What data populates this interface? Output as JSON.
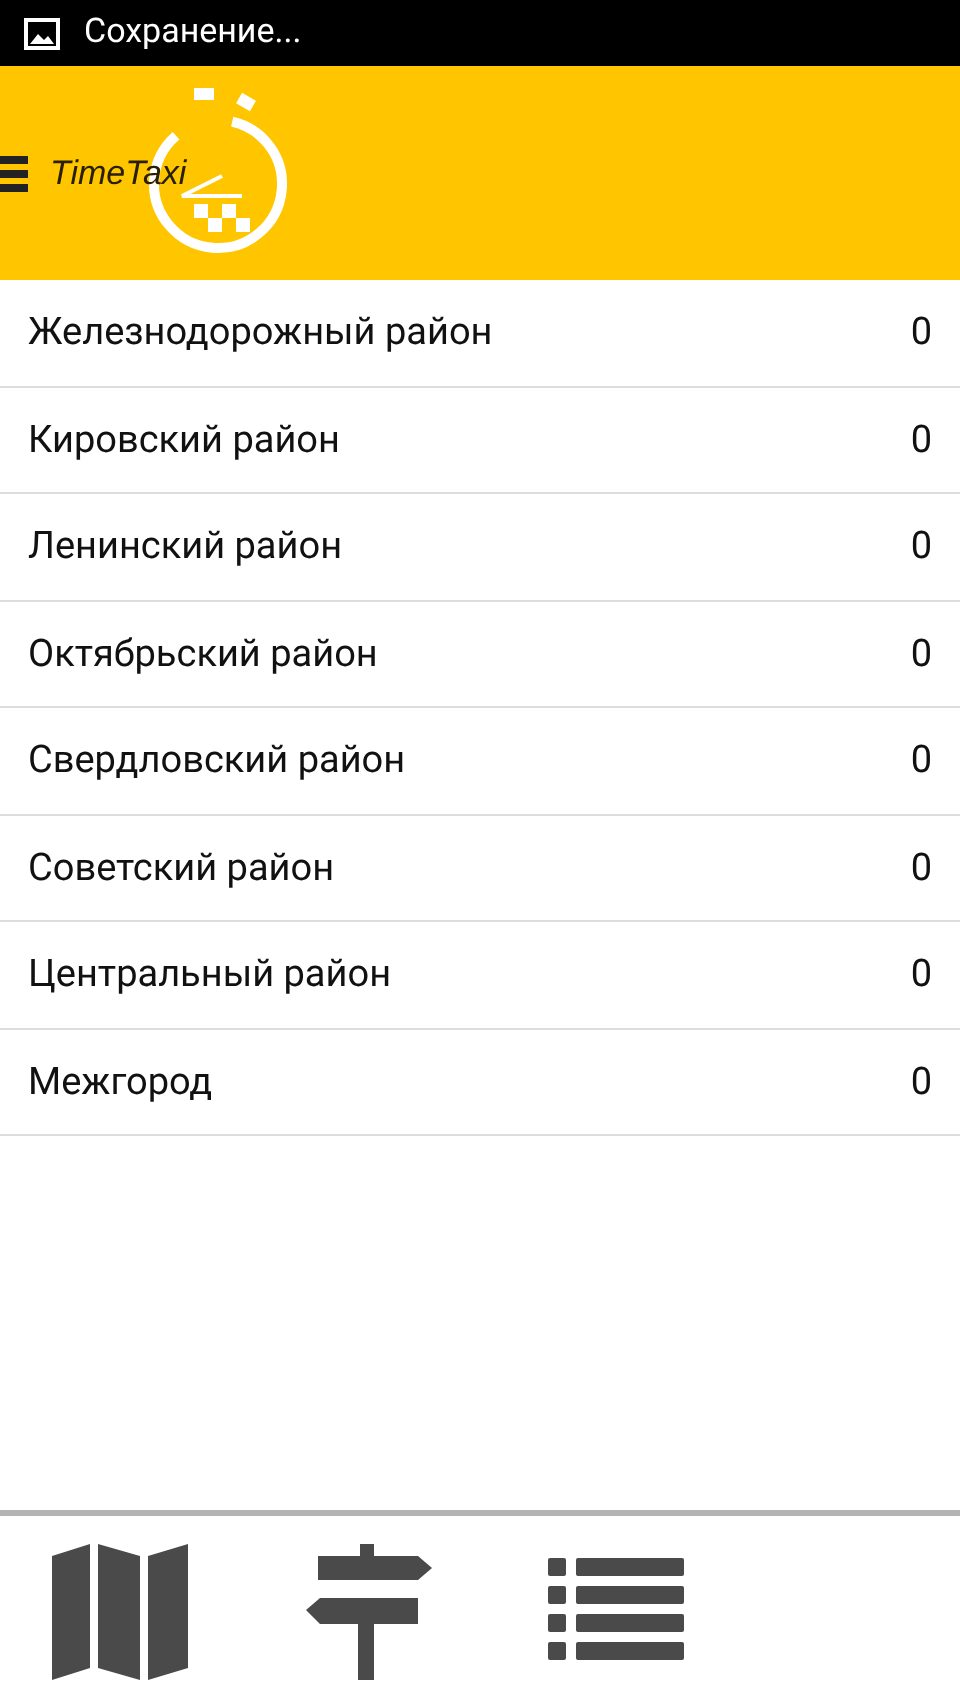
{
  "status_bar": {
    "text": "Сохранение..."
  },
  "header": {
    "logo_text": "TimeTaxi"
  },
  "districts": [
    {
      "name": "Железнодорожный район",
      "count": "0"
    },
    {
      "name": "Кировский район",
      "count": "0"
    },
    {
      "name": "Ленинский район",
      "count": "0"
    },
    {
      "name": "Октябрьский район",
      "count": "0"
    },
    {
      "name": "Свердловский район",
      "count": "0"
    },
    {
      "name": "Советский район",
      "count": "0"
    },
    {
      "name": "Центральный район",
      "count": "0"
    },
    {
      "name": "Межгород",
      "count": "0"
    }
  ],
  "bottom_nav": [
    {
      "kind": "map"
    },
    {
      "kind": "signpost"
    },
    {
      "kind": "list"
    }
  ]
}
